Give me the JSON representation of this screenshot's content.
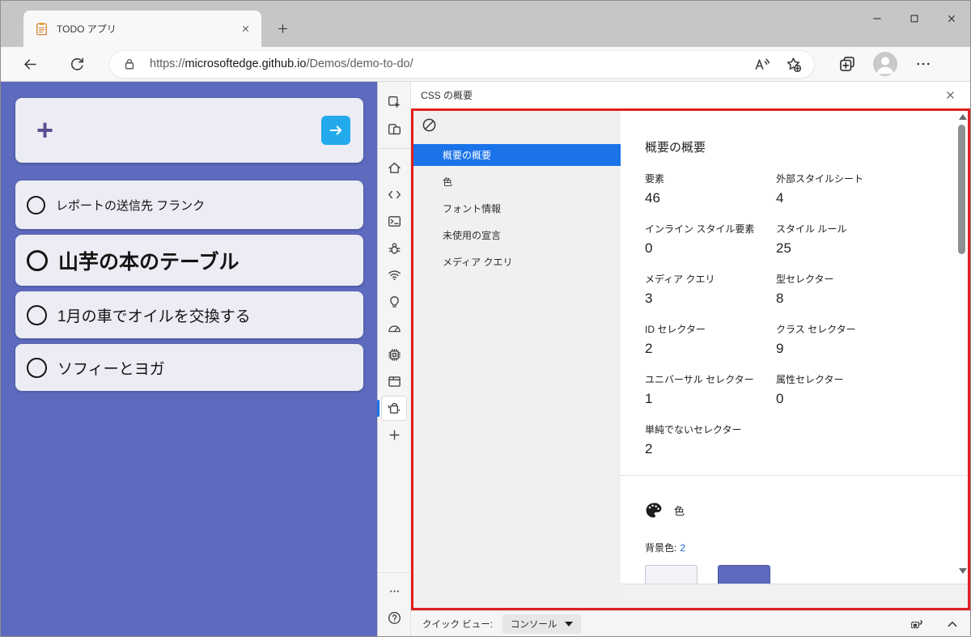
{
  "colors": {
    "accent_blue": "#1a73e8",
    "todo_background": "#5d6abe",
    "todo_card": "#ebecf4",
    "go_button_blue": "#22aaed",
    "plus_purple": "#5b4f93",
    "highlight_red": "#e01f1f",
    "swatch_light": "#f2f3f9",
    "swatch_indigo": "#5d6abe"
  },
  "browser": {
    "tab": {
      "title": "TODO アプリ"
    },
    "url": {
      "scheme": "https://",
      "host": "microsoftedge.github.io",
      "path": "/Demos/demo-to-do/"
    }
  },
  "todo_app": {
    "add_row": {
      "plus": "+"
    },
    "items": [
      {
        "label": "レポートの送信先 フランク",
        "size": "small"
      },
      {
        "label": "山芋の本のテーブル",
        "size": "large"
      },
      {
        "label": "1月の車でオイルを交換する",
        "size": "medium"
      },
      {
        "label": "ソフィーとヨガ",
        "size": "medium"
      }
    ]
  },
  "devtools": {
    "panel_title": "CSS の概要",
    "activity_bar": {
      "top_items": [
        {
          "icon": "inspect"
        },
        {
          "icon": "device-emulation"
        }
      ],
      "main_items": [
        {
          "icon": "home"
        },
        {
          "icon": "elements"
        },
        {
          "icon": "console"
        },
        {
          "icon": "debugger"
        },
        {
          "icon": "network"
        },
        {
          "icon": "issues"
        },
        {
          "icon": "performance"
        },
        {
          "icon": "memory"
        },
        {
          "icon": "application"
        },
        {
          "icon": "css-overview",
          "selected": true
        },
        {
          "icon": "more-tools"
        }
      ],
      "bottom_items": [
        {
          "icon": "more"
        },
        {
          "icon": "help"
        }
      ]
    },
    "css_overview": {
      "sidebar_items": [
        {
          "label": "概要の概要",
          "selected": true
        },
        {
          "label": "色"
        },
        {
          "label": "フォント情報"
        },
        {
          "label": "未使用の宣言"
        },
        {
          "label": "メディア クエリ"
        }
      ],
      "summary": {
        "title": "概要の概要",
        "stats": [
          {
            "label": "要素",
            "value": "46"
          },
          {
            "label": "外部スタイルシート",
            "value": "4"
          },
          {
            "label": "インライン スタイル要素",
            "value": "0"
          },
          {
            "label": "スタイル ルール",
            "value": "25"
          },
          {
            "label": "メディア クエリ",
            "value": "3"
          },
          {
            "label": "型セレクター",
            "value": "8"
          },
          {
            "label": "ID セレクター",
            "value": "2"
          },
          {
            "label": "クラス セレクター",
            "value": "9"
          },
          {
            "label": "ユニバーサル セレクター",
            "value": "1"
          },
          {
            "label": "属性セレクター",
            "value": "0"
          },
          {
            "label": "単純でないセレクター",
            "value": "2"
          }
        ]
      },
      "colors_section": {
        "title": "色",
        "background_label": "背景色:",
        "background_count": "2",
        "swatches": [
          {
            "color": "#f2f3f9",
            "cls": "light"
          },
          {
            "color": "#5d6abe"
          }
        ]
      }
    },
    "quick_view": {
      "label": "クイック ビュー:",
      "selected_tool": "コンソール"
    }
  }
}
